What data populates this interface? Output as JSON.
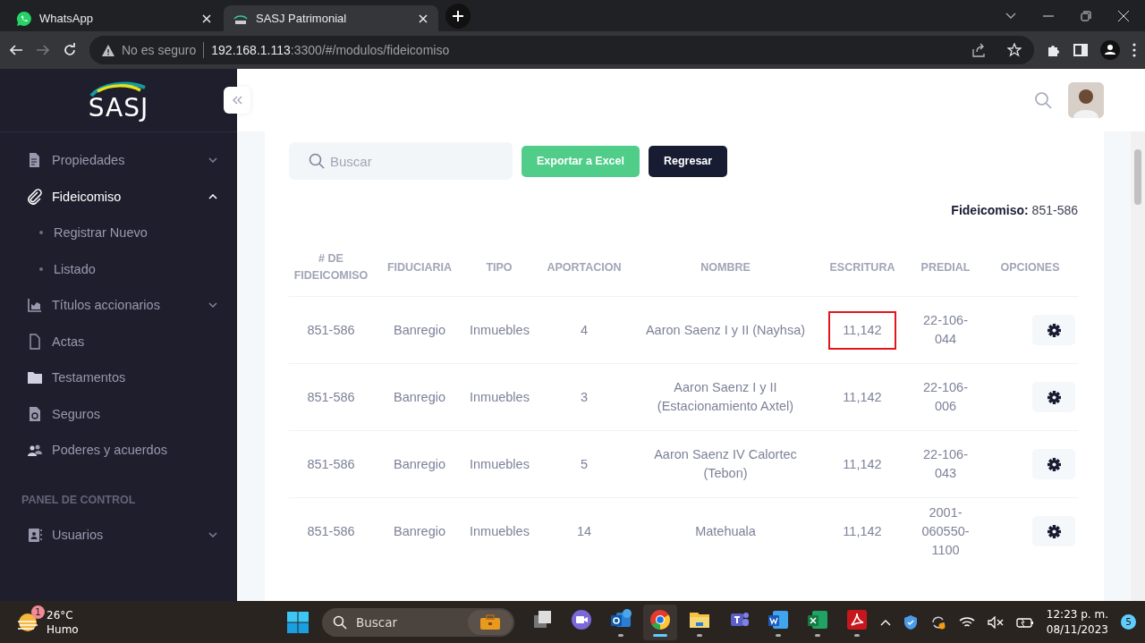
{
  "browser": {
    "tabs": [
      {
        "title": "WhatsApp",
        "kind": "whatsapp",
        "selected": false
      },
      {
        "title": "SASJ Patrimonial",
        "kind": "sasj",
        "selected": true
      }
    ],
    "address": {
      "security": "No es seguro",
      "host": "192.168.1.113",
      "rest": ":3300/#/modulos/fideicomiso"
    }
  },
  "sidebar": {
    "logo": "SASJ",
    "items": [
      {
        "label": "Propiedades",
        "kind": "document",
        "expanded": false,
        "selected": false
      },
      {
        "label": "Fideicomiso",
        "kind": "clip",
        "expanded": true,
        "selected": true,
        "children": [
          {
            "label": "Registrar Nuevo"
          },
          {
            "label": "Listado"
          }
        ]
      },
      {
        "label": "Títulos accionarios",
        "kind": "chart",
        "expanded": false,
        "selected": false
      },
      {
        "label": "Actas",
        "kind": "file",
        "selected": false
      },
      {
        "label": "Testamentos",
        "kind": "folder",
        "selected": false
      },
      {
        "label": "Seguros",
        "kind": "refresh-doc",
        "selected": false
      },
      {
        "label": "Poderes y acuerdos",
        "kind": "people",
        "selected": false
      }
    ],
    "section": "PANEL DE CONTROL",
    "section_items": [
      {
        "label": "Usuarios",
        "kind": "contacts",
        "expanded": false,
        "selected": false
      }
    ]
  },
  "toolbar": {
    "search": {
      "placeholder": "Buscar"
    },
    "buttons": [
      {
        "label": "Exportar a Excel",
        "kind": "export"
      },
      {
        "label": "Regresar",
        "kind": "back"
      }
    ]
  },
  "summary": {
    "label": "Fideicomiso:",
    "value": "851-586"
  },
  "table": {
    "columns": [
      "# DE FIDEICOMISO",
      "FIDUCIARIA",
      "TIPO",
      "APORTACION",
      "NOMBRE",
      "ESCRITURA",
      "PREDIAL",
      "OPCIONES"
    ],
    "rows": [
      {
        "fideicomiso": "851-586",
        "fiduciaria": "Banregio",
        "tipo": "Inmuebles",
        "aportacion": "4",
        "nombre": "Aaron Saenz I y II (Nayhsa)",
        "escritura": "11,142",
        "predial": "22-106-044",
        "highlighted": true
      },
      {
        "fideicomiso": "851-586",
        "fiduciaria": "Banregio",
        "tipo": "Inmuebles",
        "aportacion": "3",
        "nombre": "Aaron Saenz I y II (Estacionamiento Axtel)",
        "escritura": "11,142",
        "predial": "22-106-006",
        "highlighted": false
      },
      {
        "fideicomiso": "851-586",
        "fiduciaria": "Banregio",
        "tipo": "Inmuebles",
        "aportacion": "5",
        "nombre": "Aaron Saenz IV Calortec (Tebon)",
        "escritura": "11,142",
        "predial": "22-106-043",
        "highlighted": false
      },
      {
        "fideicomiso": "851-586",
        "fiduciaria": "Banregio",
        "tipo": "Inmuebles",
        "aportacion": "14",
        "nombre": "Matehuala",
        "escritura": "11,142",
        "predial": "2001-060550-1100",
        "highlighted": false
      }
    ]
  },
  "taskbar": {
    "weather": {
      "temp": "26°C",
      "condition": "Humo",
      "badge": "1"
    },
    "search": {
      "placeholder": "Buscar"
    },
    "apps": [
      {
        "kind": "files",
        "running": false,
        "selected": false
      },
      {
        "kind": "meet",
        "running": false,
        "selected": false
      },
      {
        "kind": "outlook",
        "running": true,
        "selected": false
      },
      {
        "kind": "chrome",
        "running": true,
        "selected": true
      },
      {
        "kind": "explorer",
        "running": true,
        "selected": false
      },
      {
        "kind": "teams",
        "running": false,
        "selected": false
      },
      {
        "kind": "word",
        "running": true,
        "selected": false
      },
      {
        "kind": "excel",
        "running": true,
        "selected": false
      },
      {
        "kind": "pdf",
        "running": true,
        "selected": false
      }
    ],
    "time": "12:23 p. m.",
    "date": "08/11/2023",
    "notifications": "5"
  }
}
